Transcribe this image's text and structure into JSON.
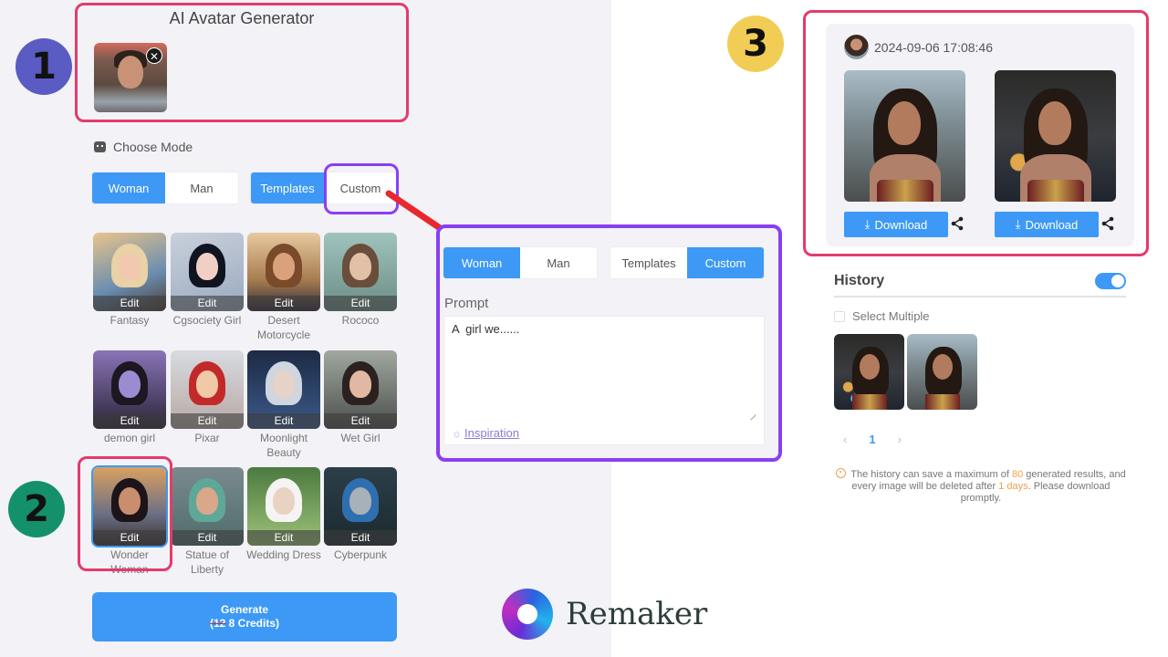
{
  "app": {
    "title": "AI Avatar Generator",
    "brand_name": "Remaker"
  },
  "annotations": {
    "badge_1": "1",
    "badge_2": "2",
    "badge_3": "3",
    "colors": {
      "badge_1": "#5b5bc4",
      "badge_2": "#14906a",
      "badge_3": "#f2cd55",
      "highlight_red": "#e43b6a",
      "highlight_purple": "#8a3ff0",
      "arrow": "#e8282e"
    }
  },
  "upload": {
    "remove_label": "✕"
  },
  "mode": {
    "heading": "Choose Mode",
    "gender_options": [
      "Woman",
      "Man"
    ],
    "gender_selected": "Woman",
    "type_options": [
      "Templates",
      "Custom"
    ],
    "type_selected_left": "Templates",
    "type_selected_right": "Custom"
  },
  "templates": [
    {
      "name": "Fantasy",
      "edit": "Edit"
    },
    {
      "name": "Cgsociety Girl",
      "edit": "Edit"
    },
    {
      "name": "Desert Motorcycle",
      "edit": "Edit"
    },
    {
      "name": "Rococo",
      "edit": "Edit"
    },
    {
      "name": "demon girl",
      "edit": "Edit"
    },
    {
      "name": "Pixar",
      "edit": "Edit"
    },
    {
      "name": "Moonlight Beauty",
      "edit": "Edit"
    },
    {
      "name": "Wet Girl",
      "edit": "Edit"
    },
    {
      "name": "Wonder Woman",
      "edit": "Edit",
      "selected": true
    },
    {
      "name": "Statue of Liberty",
      "edit": "Edit"
    },
    {
      "name": "Wedding Dress",
      "edit": "Edit"
    },
    {
      "name": "Cyberpunk",
      "edit": "Edit"
    }
  ],
  "generate": {
    "label": "Generate",
    "old_credits": "(12",
    "credits": "8 Credits)"
  },
  "custom": {
    "prompt_label": "Prompt",
    "prompt_value": "A  girl we......",
    "inspiration_label": "Inspiration"
  },
  "results": {
    "timestamp": "2024-09-06 17:08:46",
    "download_label": "Download",
    "images": 2
  },
  "history": {
    "title": "History",
    "toggle_on": true,
    "select_multiple_label": "Select Multiple",
    "thumbnails": 2,
    "pager": {
      "prev": "‹",
      "current": "1",
      "next": "›"
    },
    "notice": {
      "part1": "The history can save a maximum of ",
      "max_results": "80",
      "part2": " generated results, and every image will be deleted after ",
      "retention": "1 days",
      "part3": ". Please download promptly."
    }
  }
}
